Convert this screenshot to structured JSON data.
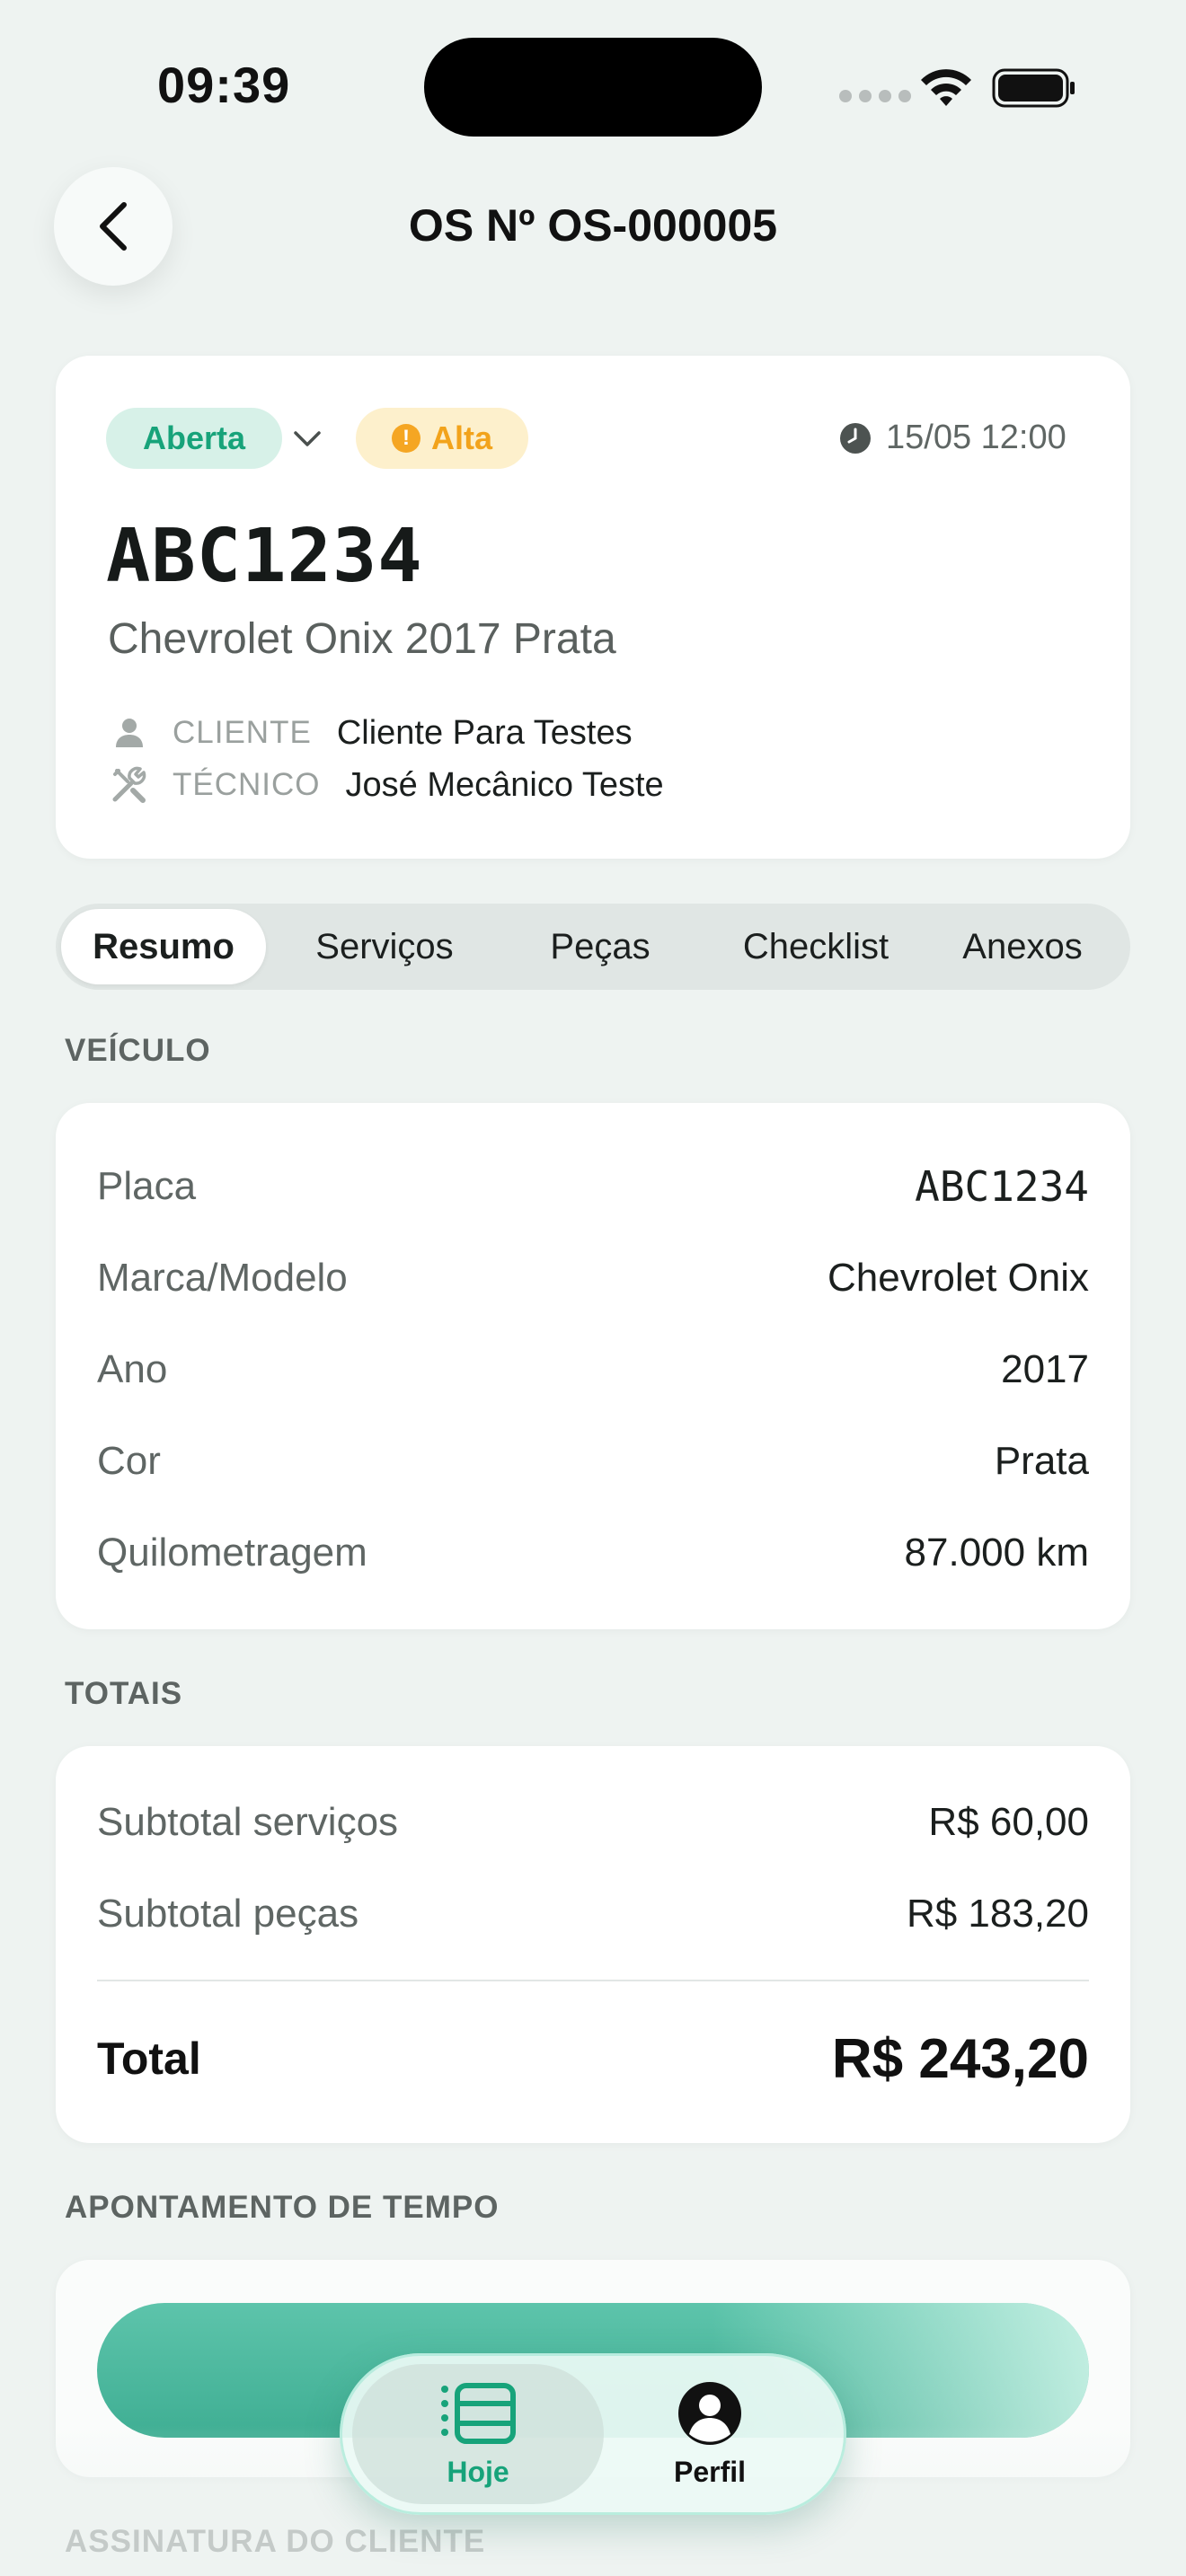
{
  "status_bar": {
    "time": "09:39"
  },
  "header": {
    "title": "OS Nº OS-000005"
  },
  "os_card": {
    "status": "Aberta",
    "priority": "Alta",
    "date": "15/05 12:00",
    "plate": "ABC1234",
    "vehicle": "Chevrolet Onix 2017 Prata",
    "client_label": "CLIENTE",
    "client_value": "Cliente Para Testes",
    "tech_label": "TÉCNICO",
    "tech_value": "José Mecânico Teste"
  },
  "tabs": [
    {
      "label": "Resumo",
      "active": true
    },
    {
      "label": "Serviços"
    },
    {
      "label": "Peças"
    },
    {
      "label": "Checklist"
    },
    {
      "label": "Anexos"
    }
  ],
  "vehicle_section": {
    "title": "VEÍCULO",
    "rows": [
      {
        "label": "Placa",
        "value": "ABC1234"
      },
      {
        "label": "Marca/Modelo",
        "value": "Chevrolet Onix"
      },
      {
        "label": "Ano",
        "value": "2017"
      },
      {
        "label": "Cor",
        "value": "Prata"
      },
      {
        "label": "Quilometragem",
        "value": "87.000 km"
      }
    ]
  },
  "totals_section": {
    "title": "TOTAIS",
    "services_label": "Subtotal serviços",
    "services_value": "R$ 60,00",
    "parts_label": "Subtotal peças",
    "parts_value": "R$ 183,20",
    "total_label": "Total",
    "total_value": "R$ 243,20"
  },
  "time_section": {
    "title": "APONTAMENTO DE TEMPO"
  },
  "signature_section": {
    "title": "ASSINATURA DO CLIENTE"
  },
  "tabbar": {
    "today_label": "Hoje",
    "profile_label": "Perfil"
  },
  "colors": {
    "accent": "#17a37a",
    "priority": "#f2a31b",
    "background": "#eef3f1"
  }
}
